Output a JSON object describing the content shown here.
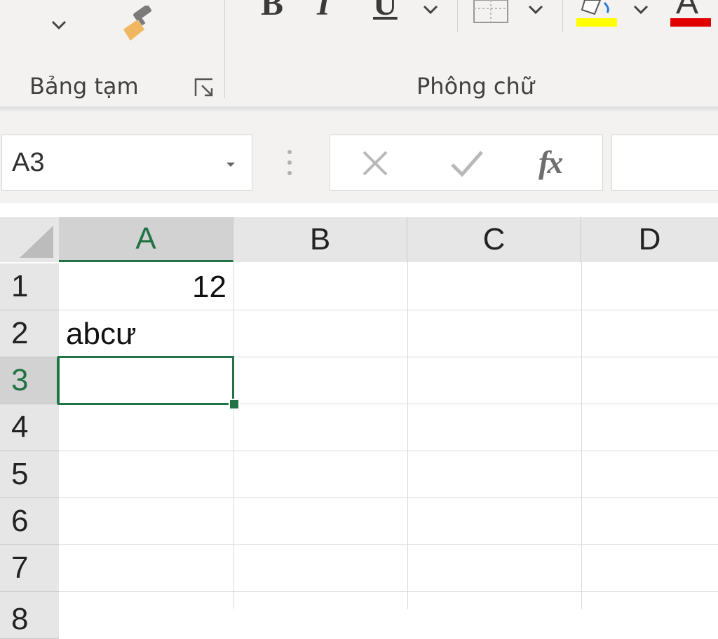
{
  "ribbon": {
    "clipboard_label": "Bảng tạm",
    "font_label": "Phông chữ",
    "bold_letter": "B",
    "italic_letter": "I",
    "underline_letter": "U",
    "font_color_letter": "A",
    "highlight_color": "#ffff00",
    "font_color": "#e00000"
  },
  "formula_bar": {
    "name_box": "A3",
    "formula": ""
  },
  "sheet": {
    "columns": [
      "A",
      "B",
      "C",
      "D"
    ],
    "rows": [
      "1",
      "2",
      "3",
      "4",
      "5",
      "6",
      "7",
      "8"
    ],
    "selected_cell": "A3",
    "cells": {
      "A1": "12",
      "A2": "abcư",
      "A3": ""
    },
    "accent_color": "#217346"
  }
}
